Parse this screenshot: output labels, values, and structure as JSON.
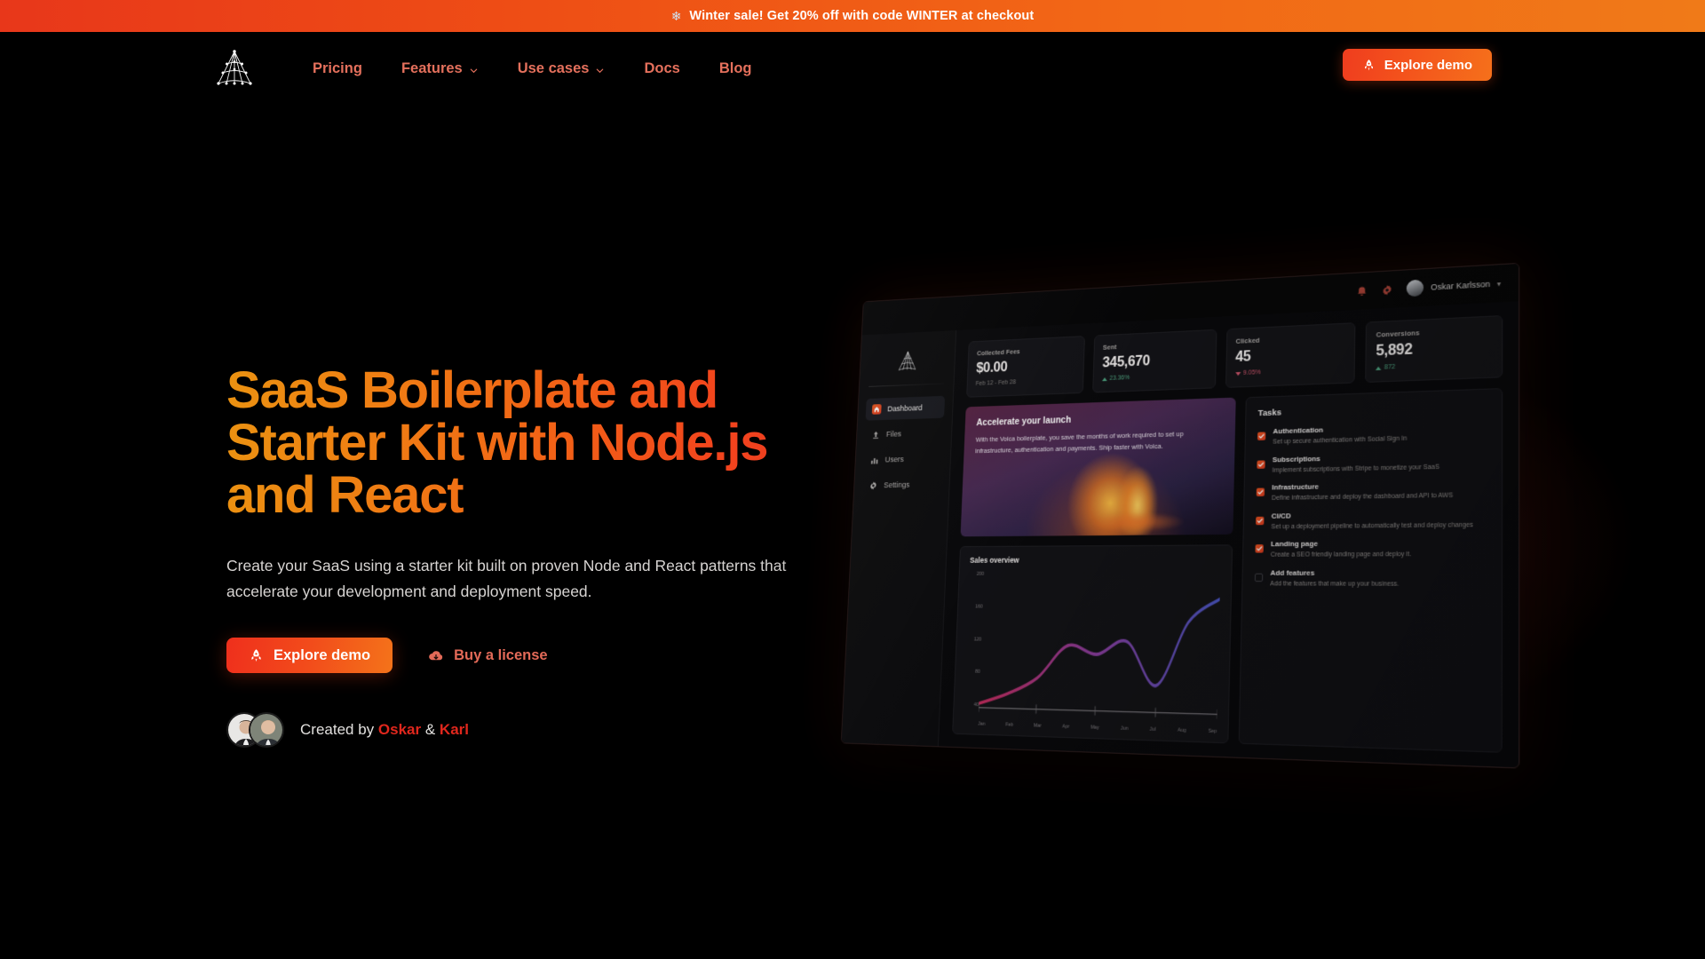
{
  "promo": {
    "icon": "snowflake-icon",
    "text": "Winter sale! Get 20% off with code WINTER at checkout",
    "bg_start": "#e8371a",
    "bg_end": "#f07a18"
  },
  "header": {
    "logo_name": "volca-web-logo",
    "nav": [
      {
        "label": "Pricing",
        "has_dropdown": false
      },
      {
        "label": "Features",
        "has_dropdown": true
      },
      {
        "label": "Use cases",
        "has_dropdown": true
      },
      {
        "label": "Docs",
        "has_dropdown": false
      },
      {
        "label": "Blog",
        "has_dropdown": false
      }
    ],
    "cta": {
      "label": "Explore demo",
      "icon": "rocket-icon"
    },
    "link_color": "#e4705c"
  },
  "hero": {
    "title": "SaaS Boilerplate and Starter Kit with Node.js and React",
    "subtitle": "Create your SaaS using a starter kit built on proven Node and React patterns that accelerate your development and deployment speed.",
    "primary_cta": {
      "label": "Explore demo",
      "icon": "rocket-icon"
    },
    "secondary_cta": {
      "label": "Buy a license",
      "icon": "cloud-download-icon"
    },
    "credits": {
      "prefix": "Created by",
      "author_one": "Oskar",
      "separator": "&",
      "author_two": "Karl",
      "name_color": "#e0271d"
    },
    "title_gradient_start": "#eb9211",
    "title_gradient_end": "#f03a20"
  },
  "mockup": {
    "topbar": {
      "icons": [
        "bell-icon",
        "gear-icon"
      ],
      "user_name": "Oskar Karlsson",
      "caret": "chevron-down-icon"
    },
    "sidebar": {
      "logo_name": "volca-web-logo",
      "items": [
        {
          "label": "Dashboard",
          "icon": "home-icon",
          "active": true
        },
        {
          "label": "Files",
          "icon": "upload-icon",
          "active": false
        },
        {
          "label": "Users",
          "icon": "users-icon",
          "active": false
        },
        {
          "label": "Settings",
          "icon": "gear-icon",
          "active": false
        }
      ]
    },
    "stats": [
      {
        "label": "Collected Fees",
        "value": "$0.00",
        "sub": "Feb 12 - Feb 28",
        "delta": "",
        "direction": ""
      },
      {
        "label": "Sent",
        "value": "345,670",
        "sub": "",
        "delta": "23.36%",
        "direction": "up"
      },
      {
        "label": "Clicked",
        "value": "45",
        "sub": "",
        "delta": "9.05%",
        "direction": "down"
      },
      {
        "label": "Conversions",
        "value": "5,892",
        "sub": "",
        "delta": "872",
        "direction": "up"
      }
    ],
    "promo_card": {
      "title": "Accelerate your launch",
      "body": "With the Volca boilerplate, you save the months of work required to set up infrastructure, authentication and payments. Ship faster with Volca."
    },
    "tasks_title": "Tasks",
    "tasks": [
      {
        "title": "Authentication",
        "desc": "Set up secure authentication with Social Sign In",
        "checked": true
      },
      {
        "title": "Subscriptions",
        "desc": "Implement subscriptions with Stripe to monetize your SaaS",
        "checked": true
      },
      {
        "title": "Infrastructure",
        "desc": "Define infrastructure and deploy the dashboard and API to AWS",
        "checked": true
      },
      {
        "title": "CI/CD",
        "desc": "Set up a deployment pipeline to automatically test and deploy changes",
        "checked": true
      },
      {
        "title": "Landing page",
        "desc": "Create a SEO friendly landing page and deploy it.",
        "checked": true
      },
      {
        "title": "Add features",
        "desc": "Add the features that make up your business.",
        "checked": false
      }
    ]
  },
  "chart_data": {
    "type": "line",
    "title": "Sales overview",
    "xlabel": "",
    "ylabel": "",
    "categories": [
      "Jan",
      "Feb",
      "Mar",
      "Apr",
      "May",
      "Jun",
      "Jul",
      "Aug",
      "Sep"
    ],
    "values": [
      45,
      58,
      78,
      118,
      108,
      124,
      72,
      148,
      176
    ],
    "ytick_labels": [
      "200",
      "160",
      "120",
      "80",
      "40"
    ],
    "ylim": [
      40,
      200
    ],
    "grid": false,
    "legend": "none",
    "line_gradient": [
      "#c2295a",
      "#8b3a9c",
      "#4a56c8"
    ]
  }
}
